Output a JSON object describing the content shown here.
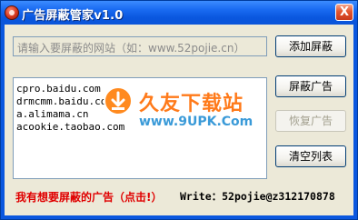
{
  "window": {
    "title": "广告屏蔽管家v1.0",
    "close_label": "X"
  },
  "url_input": {
    "placeholder": "请输入要屏蔽的网站（如：www.52pojie.cn）"
  },
  "domain_list": {
    "items": [
      "cpro.baidu.com",
      "drmcmm.baidu.com",
      "a.alimama.cn",
      "acookie.taobao.com"
    ]
  },
  "watermark": {
    "title": "久友下载站",
    "url": "www.9UPK.Com"
  },
  "buttons": {
    "add": "添加屏蔽",
    "block": "屏蔽广告",
    "restore": "恢复广告",
    "clear": "清空列表"
  },
  "footer": {
    "report_link": "我有想要屏蔽的广告（点击!）",
    "write_label": "Write：52pojie@z312170878"
  }
}
